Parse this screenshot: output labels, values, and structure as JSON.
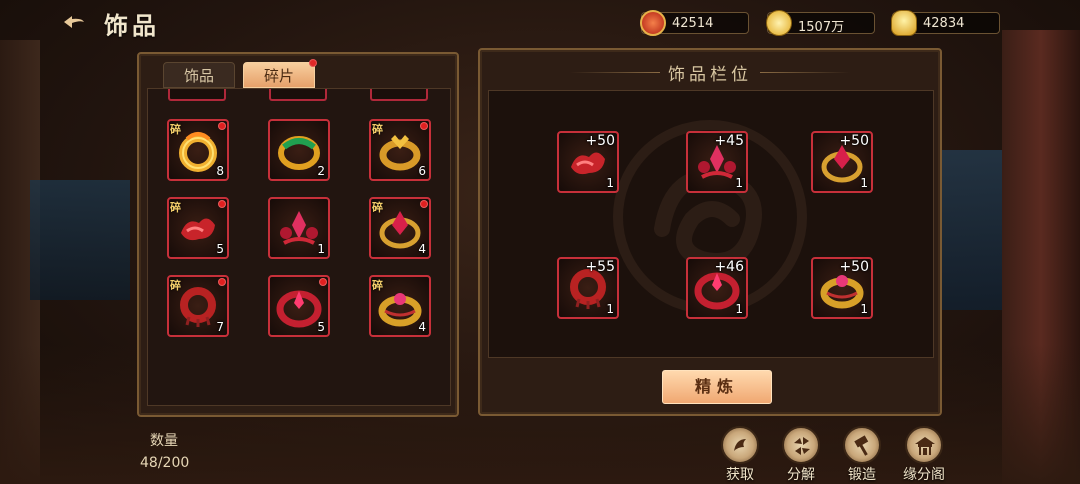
{
  "header": {
    "title": "饰品"
  },
  "resources": [
    {
      "icon": "red-gem-icon",
      "value": "42514"
    },
    {
      "icon": "gold-coin-icon",
      "value": "1507万"
    },
    {
      "icon": "gold-ingot-icon",
      "value": "42834"
    }
  ],
  "tabs": [
    {
      "label": "饰品",
      "active": false
    },
    {
      "label": "碎片",
      "active": true
    }
  ],
  "fragment_mark": "碎",
  "inventory": [
    {
      "icon": "gold-dragon-ring-icon",
      "count": "8",
      "fragment": true,
      "new": true
    },
    {
      "icon": "gold-jade-ring-icon",
      "count": "2",
      "fragment": false,
      "new": false
    },
    {
      "icon": "gold-phoenix-ring-icon",
      "count": "6",
      "fragment": true,
      "new": true
    },
    {
      "icon": "red-cloud-ring-icon",
      "count": "5",
      "fragment": true,
      "new": true
    },
    {
      "icon": "red-crystal-ornament-icon",
      "count": "1",
      "fragment": false,
      "new": false
    },
    {
      "icon": "red-gem-ring-icon",
      "count": "4",
      "fragment": true,
      "new": true
    },
    {
      "icon": "red-coiled-ring-icon",
      "count": "7",
      "fragment": true,
      "new": true
    },
    {
      "icon": "ruby-band-icon",
      "count": "5",
      "fragment": false,
      "new": true
    },
    {
      "icon": "gold-gem-ring-icon",
      "count": "4",
      "fragment": true,
      "new": false
    }
  ],
  "slots_title": "饰品栏位",
  "slots": [
    {
      "icon": "red-cloud-ring-icon",
      "plus": "+50",
      "count": "1"
    },
    {
      "icon": "red-crystal-ornament-icon",
      "plus": "+45",
      "count": "1"
    },
    {
      "icon": "red-gem-ring-icon",
      "plus": "+50",
      "count": "1"
    },
    {
      "icon": "red-coiled-ring-icon",
      "plus": "+55",
      "count": "1"
    },
    {
      "icon": "ruby-band-icon",
      "plus": "+46",
      "count": "1"
    },
    {
      "icon": "gold-gem-ring-icon",
      "plus": "+50",
      "count": "1"
    }
  ],
  "refine_label": "精炼",
  "quantity": {
    "label": "数量",
    "value": "48/200"
  },
  "actions": [
    {
      "label": "获取",
      "icon": "obtain-icon"
    },
    {
      "label": "分解",
      "icon": "decompose-icon"
    },
    {
      "label": "锻造",
      "icon": "forge-hammer-icon"
    },
    {
      "label": "缘分阁",
      "icon": "pavilion-icon"
    }
  ],
  "colors": {
    "accent": "#f0a872",
    "frame": "#c7303a",
    "panel": "#2d1d14",
    "alert": "#e02020"
  }
}
